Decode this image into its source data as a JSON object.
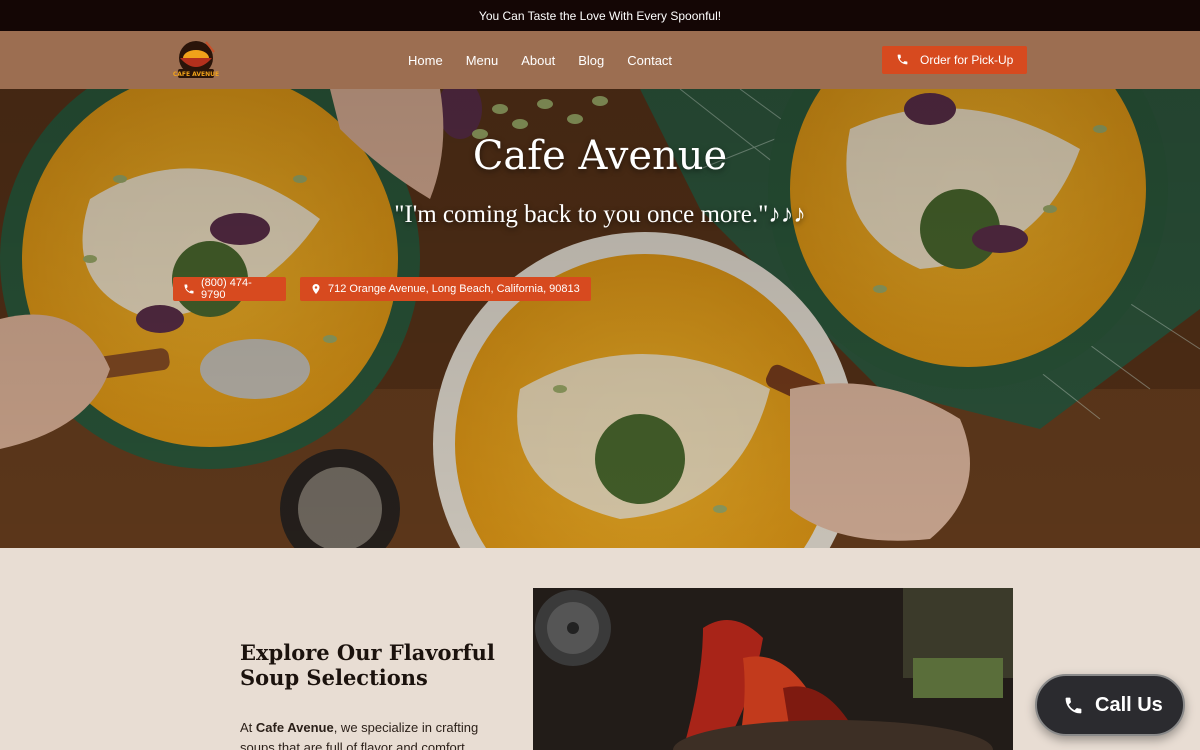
{
  "topbar": {
    "text": "You Can Taste the Love With Every Spoonful!"
  },
  "nav": {
    "logo_text": "CAFE AVENUE",
    "items": [
      {
        "label": "Home"
      },
      {
        "label": "Menu"
      },
      {
        "label": "About"
      },
      {
        "label": "Blog"
      },
      {
        "label": "Contact"
      }
    ],
    "order_button": {
      "label": "Order for Pick-Up",
      "icon": "phone-icon"
    }
  },
  "hero": {
    "title": "Cafe Avenue",
    "quote": "\"I'm coming back to you once more.\"♪♪♪",
    "phone": {
      "label": "(800) 474-9790",
      "icon": "phone-icon"
    },
    "address": {
      "label": "712 Orange Avenue,  Long Beach, California, 90813",
      "icon": "map-pin-icon"
    }
  },
  "section": {
    "title": "Explore Our Flavorful Soup Selections",
    "text_prefix": "At ",
    "text_brand": "Cafe Avenue",
    "text_rest": ", we specialize in crafting soups that are full of flavor and comfort"
  },
  "call_button": {
    "label": "Call Us",
    "icon": "phone-icon"
  },
  "colors": {
    "accent": "#d74a1f",
    "nav": "#9c6e51",
    "topbar": "#140605",
    "section_bg": "#e8ddd3"
  }
}
